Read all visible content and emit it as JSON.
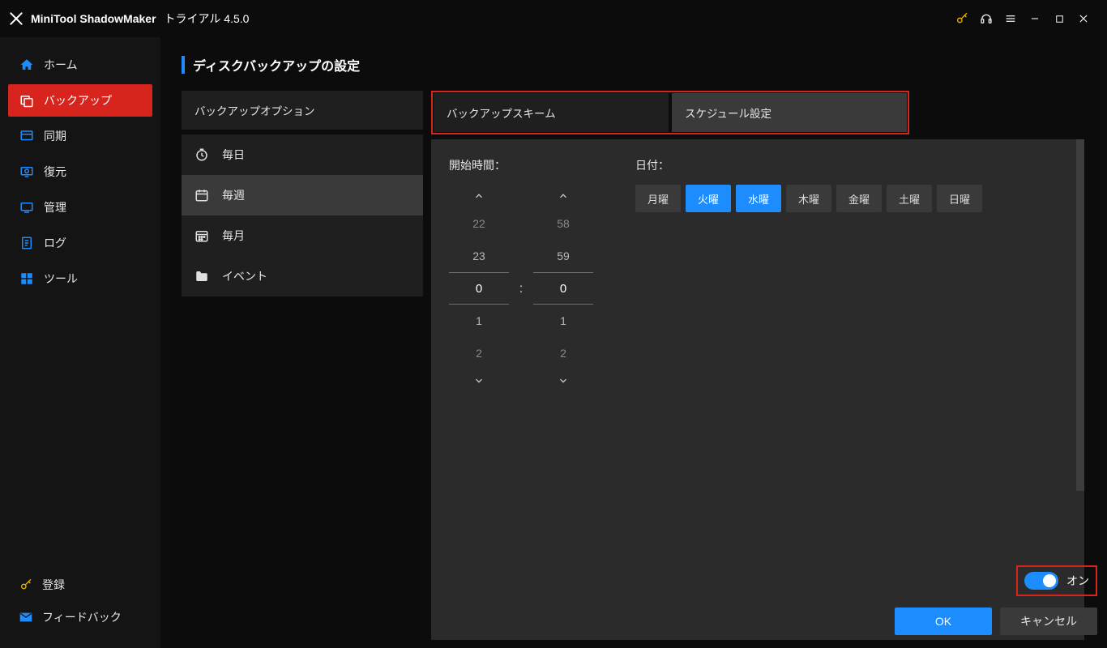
{
  "app": {
    "title_main": "MiniTool ShadowMaker",
    "title_sub": "トライアル 4.5.0"
  },
  "sidebar": {
    "items": [
      {
        "id": "home",
        "label": "ホーム"
      },
      {
        "id": "backup",
        "label": "バックアップ"
      },
      {
        "id": "sync",
        "label": "同期"
      },
      {
        "id": "restore",
        "label": "復元"
      },
      {
        "id": "manage",
        "label": "管理"
      },
      {
        "id": "log",
        "label": "ログ"
      },
      {
        "id": "tools",
        "label": "ツール"
      }
    ],
    "bottom": {
      "register": "登録",
      "feedback": "フィードバック"
    },
    "active": "backup"
  },
  "page": {
    "title": "ディスクバックアップの設定"
  },
  "tabs": [
    {
      "id": "options",
      "label": "バックアップオプション"
    },
    {
      "id": "scheme",
      "label": "バックアップスキーム"
    },
    {
      "id": "schedule",
      "label": "スケジュール設定"
    }
  ],
  "periods": [
    {
      "id": "daily",
      "label": "毎日"
    },
    {
      "id": "weekly",
      "label": "毎週"
    },
    {
      "id": "monthly",
      "label": "毎月"
    },
    {
      "id": "event",
      "label": "イベント"
    }
  ],
  "selected_period": "weekly",
  "schedule": {
    "start_label": "開始時間：",
    "date_label": "日付：",
    "hours": {
      "prev2": "22",
      "prev1": "23",
      "current": "0",
      "next1": "1",
      "next2": "2"
    },
    "minutes": {
      "prev2": "58",
      "prev1": "59",
      "current": "0",
      "next1": "1",
      "next2": "2"
    },
    "days": [
      {
        "id": "mon",
        "label": "月曜",
        "selected": false
      },
      {
        "id": "tue",
        "label": "火曜",
        "selected": true
      },
      {
        "id": "wed",
        "label": "水曜",
        "selected": true
      },
      {
        "id": "thu",
        "label": "木曜",
        "selected": false
      },
      {
        "id": "fri",
        "label": "金曜",
        "selected": false
      },
      {
        "id": "sat",
        "label": "土曜",
        "selected": false
      },
      {
        "id": "sun",
        "label": "日曜",
        "selected": false
      }
    ]
  },
  "footer": {
    "toggle_label": "オン",
    "toggle_state": true,
    "ok": "OK",
    "cancel": "キャンセル"
  }
}
